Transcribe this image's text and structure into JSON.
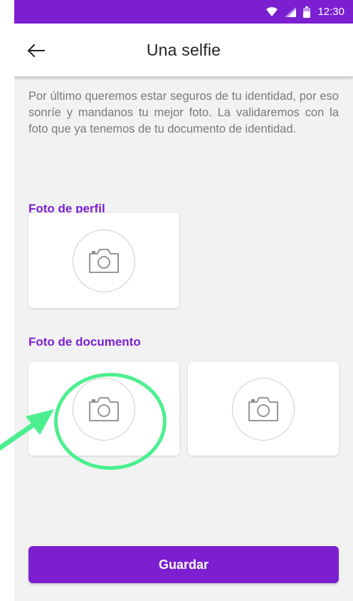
{
  "status_bar": {
    "time": "12:30",
    "icons": [
      "wifi-icon",
      "signal-icon",
      "battery-icon"
    ]
  },
  "app_bar": {
    "back_icon": "arrow-back-icon",
    "title": "Una selfie"
  },
  "intro_text": "Por último queremos estar seguros de tu identidad, por eso sonríe y mandanos tu mejor foto. La validaremos con la foto que ya tenemos de tu documento de identidad.",
  "sections": {
    "profile": {
      "title": "Foto de perfil",
      "slots": [
        {
          "icon": "camera-icon"
        }
      ]
    },
    "document": {
      "title": "Foto de documento",
      "slots": [
        {
          "icon": "camera-icon",
          "highlighted": true
        },
        {
          "icon": "camera-icon"
        }
      ]
    }
  },
  "annotation": {
    "highlight_color": "#4cef8f",
    "target": "document-photo-front"
  },
  "save_button": {
    "label": "Guardar"
  },
  "colors": {
    "brand": "#7b1fd1",
    "background": "#f2f2f2",
    "text_muted": "#7a7a7a"
  }
}
